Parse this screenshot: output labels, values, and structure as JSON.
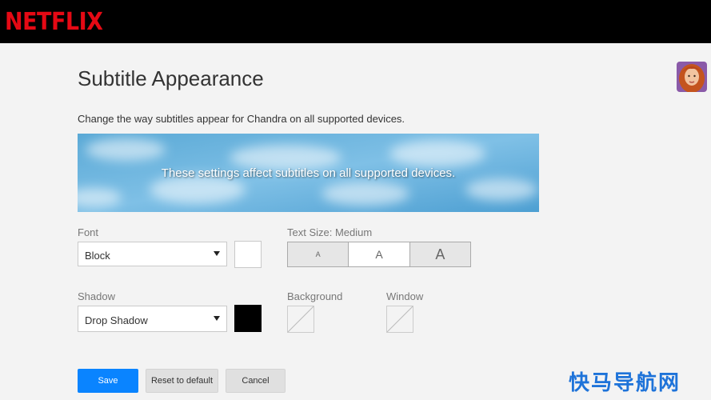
{
  "header": {
    "logo_text": "NETFLIX",
    "logo_color": "#e50914"
  },
  "page": {
    "title": "Subtitle Appearance",
    "description": "Change the way subtitles appear for Chandra on all supported devices."
  },
  "preview": {
    "text": "These settings affect subtitles on all supported devices."
  },
  "font": {
    "label": "Font",
    "value": "Block",
    "color": "#ffffff"
  },
  "text_size": {
    "label": "Text Size: Medium",
    "options": [
      "A",
      "A",
      "A"
    ],
    "selected": "Medium"
  },
  "shadow": {
    "label": "Shadow",
    "value": "Drop Shadow",
    "color": "#000000"
  },
  "background": {
    "label": "Background"
  },
  "window": {
    "label": "Window"
  },
  "buttons": {
    "save": "Save",
    "reset": "Reset to default",
    "cancel": "Cancel"
  },
  "accent_color": "#0a84ff",
  "watermark": "快马导航网"
}
